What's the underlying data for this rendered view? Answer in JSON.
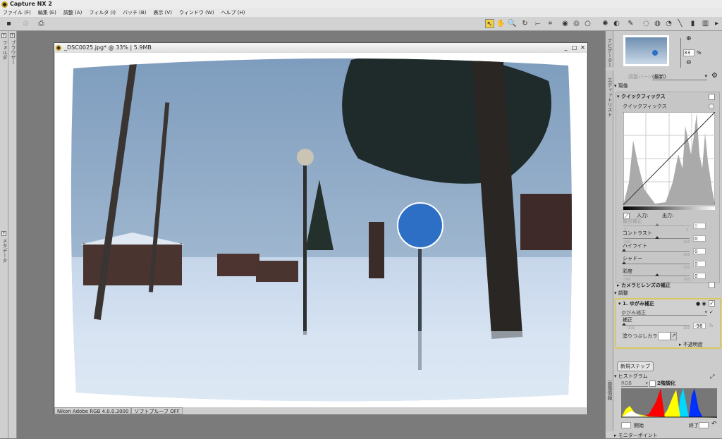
{
  "app": {
    "title": "Capture NX 2"
  },
  "menu": [
    "ファイル (F)",
    "編集 (E)",
    "調整 (A)",
    "フィルタ (I)",
    "バッチ (B)",
    "表示 (V)",
    "ウィンドウ (W)",
    "ヘルプ (H)"
  ],
  "left_tabs": {
    "folders": "フォルダ",
    "browser": "ブラウザー",
    "metadata": "メタデータ"
  },
  "document": {
    "title": "_DSC0025.jpg* @ 33% | 5.9MB",
    "color_profile": "Nikon Adobe RGB 4.0.0.3000",
    "soft_proof": "ソフトプルーフ OFF"
  },
  "navigator": {
    "tab": "ナビゲーター",
    "zoom_value": "33",
    "zoom_unit": "%"
  },
  "edit_list": {
    "tab": "エディットリスト",
    "version_label": "調整バージョン",
    "version_value": "(最新)",
    "develop": "現像",
    "quick_fix": {
      "header": "クイックフィックス",
      "sub": "クイックフィックス",
      "input": "入力:",
      "output": "出力:",
      "sliders": [
        {
          "label": "露出補正",
          "min": "-2",
          "max": "2",
          "value": "0",
          "pos": 0.5,
          "disabled": true
        },
        {
          "label": "コントラスト",
          "min": "-100",
          "max": "100",
          "value": "0",
          "pos": 0.5
        },
        {
          "label": "ハイライト",
          "min": "",
          "max": "100",
          "value": "0",
          "pos": 0
        },
        {
          "label": "シャドー",
          "min": "",
          "max": "100",
          "value": "0",
          "pos": 0
        },
        {
          "label": "彩度",
          "min": "-100",
          "max": "100",
          "value": "0",
          "pos": 0.5
        }
      ]
    },
    "camera_lens": "カメラとレンズの補正",
    "adjust": "調整",
    "step": {
      "title": "1. ゆがみ補正",
      "type": "ゆがみ補正",
      "amount_label": "補正",
      "amount_min": "-100",
      "amount_max": "100",
      "amount_value": "-98",
      "amount_unit": "%",
      "amount_pos": 0.01,
      "fill_color_label": "塗りつぶしカラー",
      "opacity": "不透明度"
    },
    "new_step": "新規ステップ"
  },
  "histogram": {
    "tab": "画像情報",
    "title": "ヒストグラム",
    "channel": "RGB",
    "gradation": "2階調化",
    "start_label": "開始",
    "end_label": "終了"
  },
  "monitor_point": "モニターポイント",
  "colors": {
    "accent": "#d8c860",
    "workspace": "#7b7b7b"
  }
}
